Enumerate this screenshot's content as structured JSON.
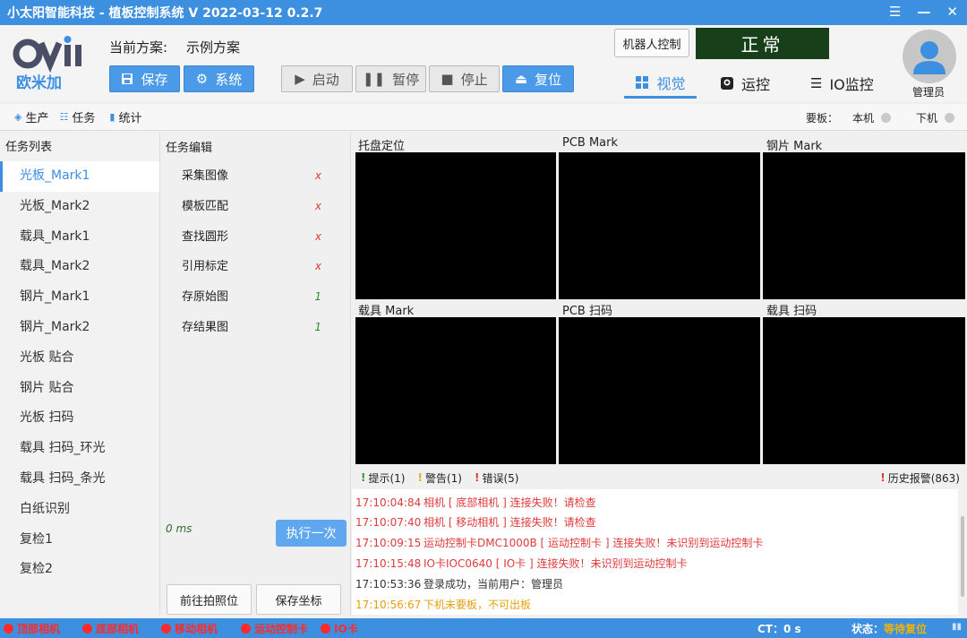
{
  "window": {
    "title": "小太阳智能科技 - 植板控制系统  V 2022-03-12 0.2.7"
  },
  "header": {
    "logo_text": "欧米加",
    "scheme_label": "当前方案:",
    "scheme_value": "示例方案",
    "robot_control": "机器人控制",
    "status": "正常",
    "user": "管理员"
  },
  "toolbar": {
    "save": "保存",
    "system": "系统",
    "start": "启动",
    "pause": "暂停",
    "stop": "停止",
    "reset": "复位"
  },
  "nav": {
    "vision": "视觉",
    "motion": "运控",
    "io": "IO监控"
  },
  "subnav": {
    "production": "生产",
    "task": "任务",
    "stats": "统计",
    "board_label": "要板：",
    "local": "本机",
    "downstream": "下机"
  },
  "tasklist": {
    "header": "任务列表",
    "items": [
      "光板_Mark1",
      "光板_Mark2",
      "载具_Mark1",
      "载具_Mark2",
      "钢片_Mark1",
      "钢片_Mark2",
      "光板 贴合",
      "钢片 贴合",
      "光板 扫码",
      "载具 扫码_环光",
      "载具 扫码_条光",
      "白纸识别",
      "复检1",
      "复检2"
    ]
  },
  "taskedit": {
    "header": "任务编辑",
    "steps": [
      {
        "name": "采集图像",
        "mark": "x"
      },
      {
        "name": "模板匹配",
        "mark": "x"
      },
      {
        "name": "查找圆形",
        "mark": "x"
      },
      {
        "name": "引用标定",
        "mark": "x"
      },
      {
        "name": "存原始图",
        "mark": "1"
      },
      {
        "name": "存结果图",
        "mark": "1"
      }
    ],
    "elapsed": "0 ms",
    "execute_once": "执行一次",
    "goto_photo": "前往拍照位",
    "save_coords": "保存坐标"
  },
  "cameras": [
    "托盘定位",
    "PCB Mark",
    "钢片 Mark",
    "载具 Mark",
    "PCB 扫码",
    "载具 扫码"
  ],
  "logs": {
    "hint": "提示(1)",
    "warn": "警告(1)",
    "error": "错误(5)",
    "history": "历史报警(863)",
    "lines": [
      {
        "time": "17:10:04:84",
        "text": "相机 [ 底部相机 ] 连接失败！请检查",
        "level": "err"
      },
      {
        "time": "17:10:07:40",
        "text": "相机 [ 移动相机 ] 连接失败！请检查",
        "level": "err"
      },
      {
        "time": "17:10:09:15",
        "text": "运动控制卡DMC1000B [ 运动控制卡 ] 连接失败！未识别到运动控制卡",
        "level": "err"
      },
      {
        "time": "17:10:15:48",
        "text": "IO卡IOC0640 [ IO卡 ] 连接失败！未识别到运动控制卡",
        "level": "err"
      },
      {
        "time": "17:10:53:36",
        "text": "登录成功，当前用户：管理员",
        "level": "info"
      },
      {
        "time": "17:10:56:67",
        "text": "下机未要板，不可出板",
        "level": "warn"
      }
    ]
  },
  "statusbar": {
    "devices": [
      "顶部相机",
      "底部相机",
      "移动相机",
      "运动控制卡",
      "IO卡"
    ],
    "ct_label": "CT：",
    "ct_value": "0 s",
    "state_label": "状态：",
    "state_value": "等待复位"
  },
  "colors": {
    "accent": "#3d8fe0",
    "status_bg": "#173f1a",
    "error": "#e03a3a",
    "warning": "#e6a010",
    "ok": "#2e8b2e"
  }
}
